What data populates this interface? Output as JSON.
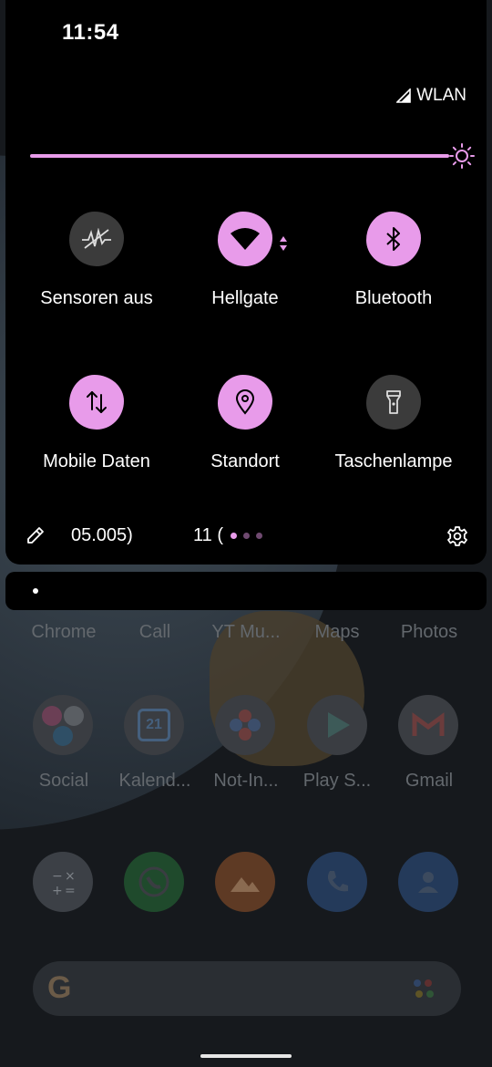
{
  "status_bar": {
    "time": "11:54",
    "network_label": "WLAN"
  },
  "quick_settings": {
    "tiles": [
      {
        "label": "Sensoren aus",
        "state": "off",
        "icon": "sensors-off-icon"
      },
      {
        "label": "Hellgate",
        "state": "on",
        "icon": "wifi-icon"
      },
      {
        "label": "Bluetooth",
        "state": "on",
        "icon": "bluetooth-icon"
      },
      {
        "label": "Mobile Daten",
        "state": "on",
        "icon": "mobile-data-icon"
      },
      {
        "label": "Standort",
        "state": "on",
        "icon": "location-icon"
      },
      {
        "label": "Taschenlampe",
        "state": "off",
        "icon": "flashlight-icon"
      }
    ],
    "footer": {
      "text_left": "05.005)",
      "text_right": "11 ("
    },
    "accent_color": "#e89bea"
  },
  "home": {
    "dock_row1": [
      "Chrome",
      "Call",
      "YT Mu...",
      "Maps",
      "Photos"
    ],
    "apps_row2": [
      "Social",
      "Kalend...",
      "Not-In...",
      "Play S...",
      "Gmail"
    ],
    "calendar_day": "21"
  }
}
